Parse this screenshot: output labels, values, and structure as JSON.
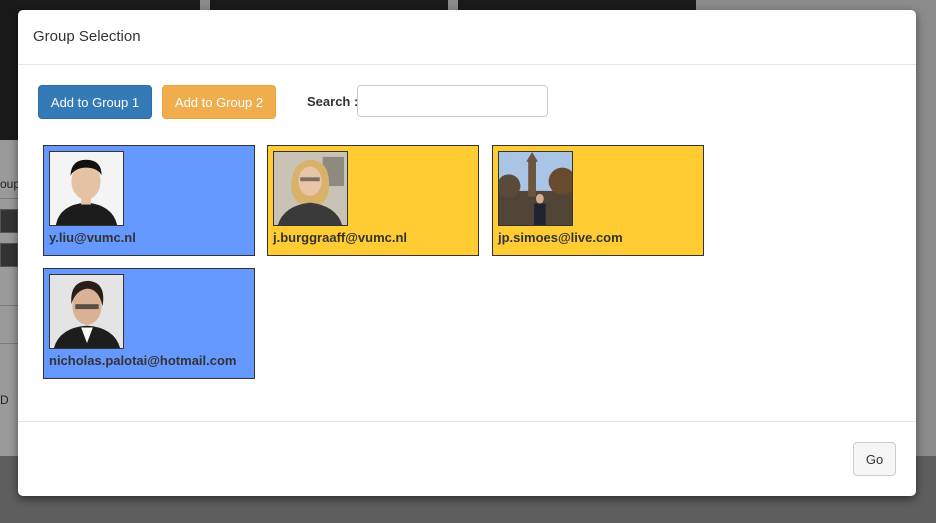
{
  "background": {
    "fragment_text": "oup",
    "fragment_text_2": "D"
  },
  "modal": {
    "title": "Group Selection",
    "toolbar": {
      "add_group1_label": "Add to Group 1",
      "add_group2_label": "Add to Group 2",
      "search_label": "Search :",
      "search_value": ""
    },
    "users": [
      {
        "email": "y.liu@vumc.nl",
        "group": 1,
        "avatar_icon": "person-photo"
      },
      {
        "email": "j.burggraaff@vumc.nl",
        "group": 2,
        "avatar_icon": "person-photo"
      },
      {
        "email": "jp.simoes@live.com",
        "group": 2,
        "avatar_icon": "person-photo"
      },
      {
        "email": "nicholas.palotai@hotmail.com",
        "group": 1,
        "avatar_icon": "person-photo"
      }
    ],
    "footer": {
      "go_label": "Go"
    }
  },
  "colors": {
    "group1_card": "#6699ff",
    "group2_card": "#ffcc33",
    "group1_button": "#337ab7",
    "group2_button": "#f0ad4e"
  }
}
